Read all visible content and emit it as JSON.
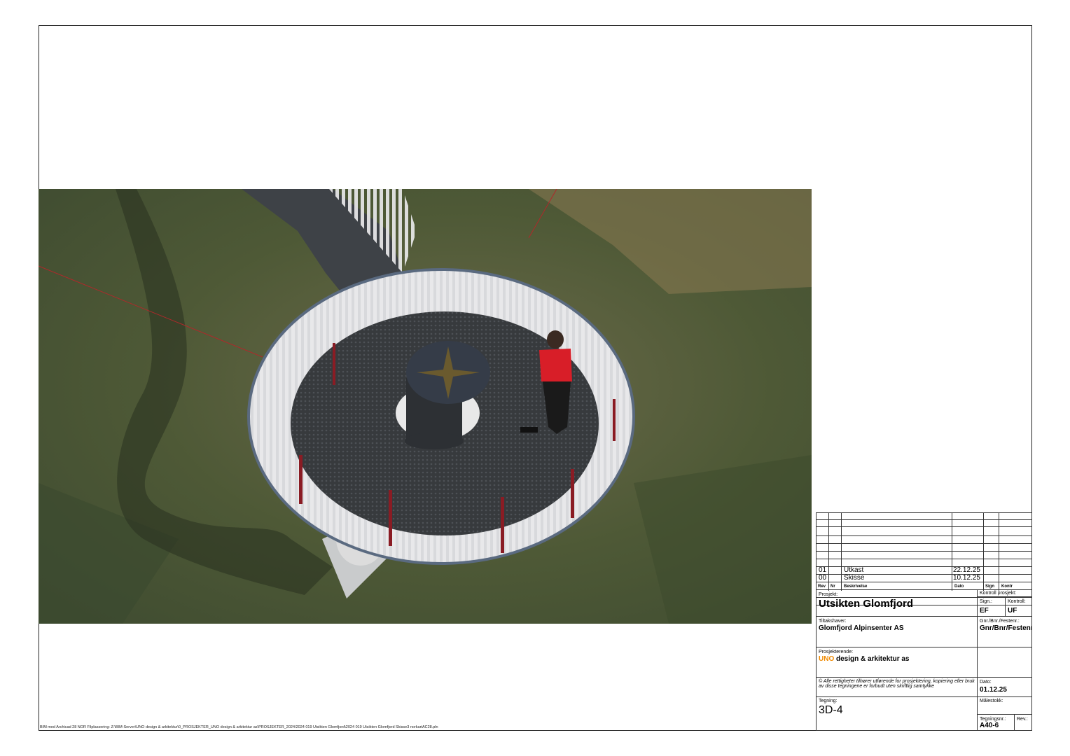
{
  "revisions": [
    {
      "rev": "01",
      "desc": "Utkast",
      "date": "22.12.25"
    },
    {
      "rev": "00",
      "desc": "Skisse",
      "date": "10.12.25"
    }
  ],
  "rev_headers": {
    "rev": "Rev",
    "nr": "Nr",
    "desc": "Beskrivelse",
    "date": "Dato",
    "sign": "Sign",
    "kontr": "Kontr"
  },
  "project": {
    "label": "Prosjekt:",
    "name": "Utsikten Glomfjord"
  },
  "control": {
    "label": "Kontroll prosjekt:",
    "sign_label": "Sign.:",
    "sign_value": "EF",
    "kontroll_label": "Kontroll:",
    "kontroll_value": "UF"
  },
  "owner": {
    "label": "Tiltakshaver:",
    "name": "Glomfjord Alpinsenter AS"
  },
  "property": {
    "label": "Gnr./Bnr./Festenr.:",
    "value": "Gnr/Bnr/Festenr"
  },
  "designer": {
    "label": "Prosjekterende:",
    "brand": "UNO",
    "name": " design & arkitektur as"
  },
  "copyright": "© Alle rettigheter tilhører utførende for prosjektering, kopiering eller bruk av disse tegningene er forbudt uten skriftlig samtykke",
  "date": {
    "label": "Dato:",
    "value": "01.12.25"
  },
  "scale": {
    "label": "Målestokk:",
    "value": ""
  },
  "drawing": {
    "label": "Tegning:",
    "value": "3D-4"
  },
  "drawing_no": {
    "label": "Tegningsnr.:",
    "value": "A40-6"
  },
  "revision": {
    "label": "Rev.:",
    "value": ""
  },
  "footnote": "BIM med Archicad 28 NOR  Filplassering: Z:\\BIM-Server\\UNO design & arkitektur\\0_PROSJEKTER_UNO design & arkitektur as\\PROSJEKTER_2024\\2024 019 Utsikten Glomfjord\\2024 019 Utsikten Glomfjord Skisse3 norkartAC28.pln",
  "colors": {
    "ground": "#4f5a34",
    "railing": "#e8e8ea",
    "posts": "#8a1c24",
    "shirt": "#d81e28",
    "deck": "#3d4043"
  }
}
